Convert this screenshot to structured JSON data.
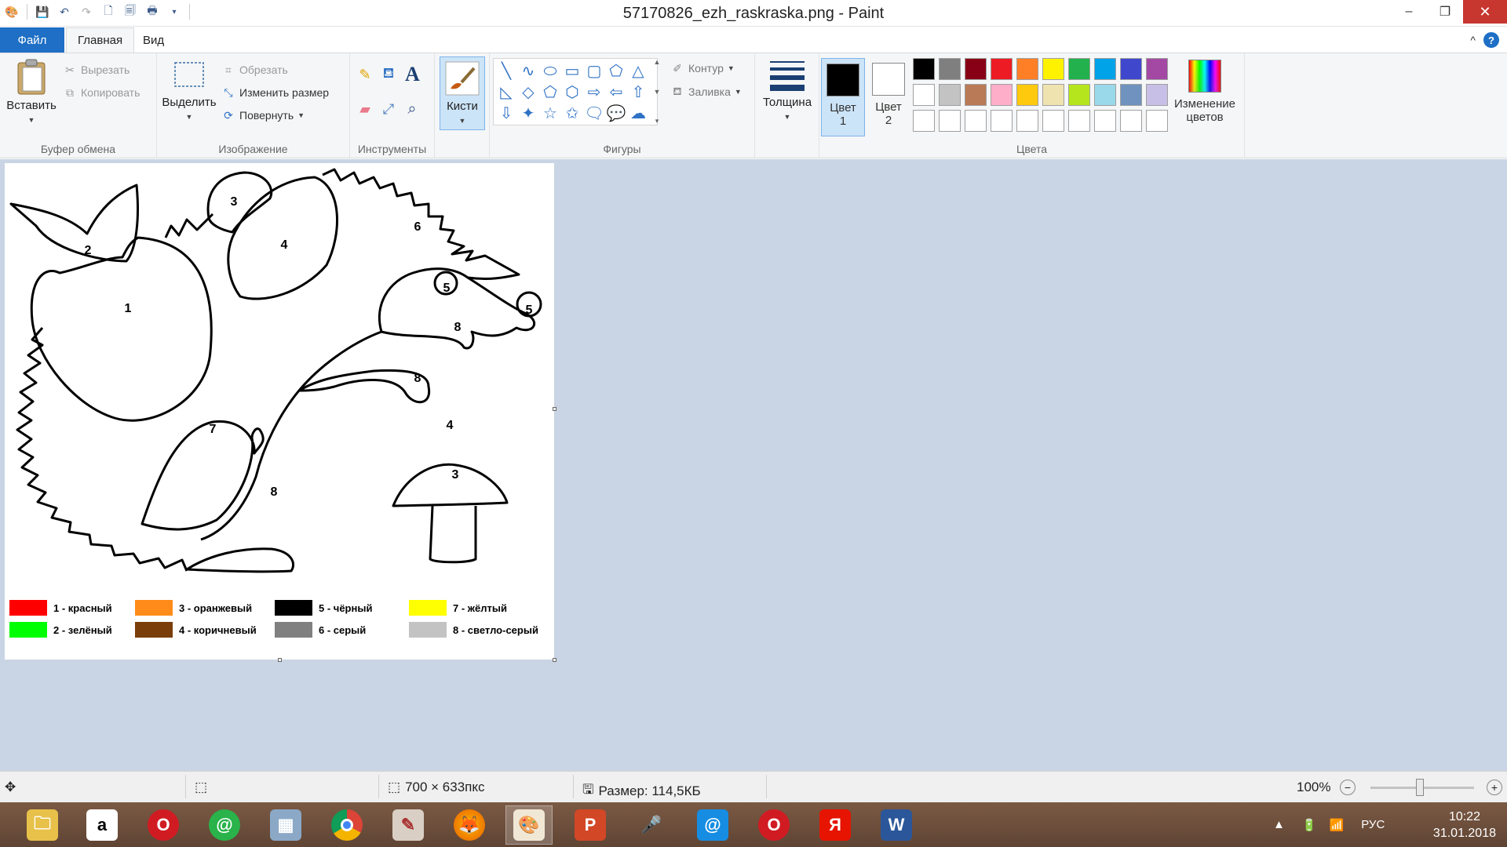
{
  "window": {
    "title": "57170826_ezh_raskraska.png - Paint",
    "minimize": "–",
    "maximize": "❐",
    "close": "✕"
  },
  "tabs": {
    "file": "Файл",
    "home": "Главная",
    "view": "Вид",
    "collapse": "^",
    "help": "?"
  },
  "clipboard": {
    "paste": "Вставить",
    "cut": "Вырезать",
    "copy": "Копировать",
    "label": "Буфер обмена"
  },
  "image": {
    "select": "Выделить",
    "crop": "Обрезать",
    "resize": "Изменить размер",
    "rotate": "Повернуть",
    "label": "Изображение"
  },
  "tools": {
    "label": "Инструменты",
    "text_tool": "A"
  },
  "brushes": {
    "label": "Кисти"
  },
  "shapes": {
    "outline": "Контур",
    "fill": "Заливка",
    "label": "Фигуры",
    "glyphs": [
      "╲",
      "∿",
      "⬭",
      "▭",
      "▢",
      "⬠",
      "△",
      "◺",
      "◇",
      "⬠",
      "⬡",
      "⇨",
      "⇦",
      "⇧",
      "⇩",
      "✦",
      "☆",
      "✩",
      "🗨",
      "💬",
      "☁"
    ]
  },
  "thickness": {
    "label": "Толщина"
  },
  "colors": {
    "color1_label": "Цвет",
    "color1_num": "1",
    "color1_value": "#000000",
    "color2_label": "Цвет",
    "color2_num": "2",
    "color2_value": "#ffffff",
    "edit_line1": "Изменение",
    "edit_line2": "цветов",
    "label": "Цвета",
    "palette": [
      "#000000",
      "#7f7f7f",
      "#880015",
      "#ed1c24",
      "#ff7f27",
      "#fff200",
      "#22b14c",
      "#00a2e8",
      "#3f48cc",
      "#a349a4",
      "#ffffff",
      "#c3c3c3",
      "#b97a57",
      "#ffaec9",
      "#ffc90e",
      "#efe4b0",
      "#b5e61d",
      "#99d9ea",
      "#7092be",
      "#c8bfe7",
      "#ffffff",
      "#ffffff",
      "#ffffff",
      "#ffffff",
      "#ffffff",
      "#ffffff",
      "#ffffff",
      "#ffffff",
      "#ffffff",
      "#ffffff"
    ]
  },
  "picture": {
    "numbers": [
      "2",
      "3",
      "4",
      "6",
      "1",
      "5",
      "5",
      "8",
      "8",
      "4",
      "7",
      "3",
      "8"
    ],
    "legend": [
      {
        "color": "#ff0000",
        "text": "1 - красный"
      },
      {
        "color": "#ff8c1a",
        "text": "3 - оранжевый"
      },
      {
        "color": "#000000",
        "text": "5 - чёрный"
      },
      {
        "color": "#ffff00",
        "text": "7 - жёлтый"
      },
      {
        "color": "#00ff00",
        "text": "2 - зелёный"
      },
      {
        "color": "#7a3e0a",
        "text": "4 - коричневый"
      },
      {
        "color": "#808080",
        "text": "6 - серый"
      },
      {
        "color": "#c3c3c3",
        "text": "8 - светло-серый"
      }
    ]
  },
  "status": {
    "dimensions": "700 × 633пкс",
    "size": "Размер: 114,5КБ",
    "zoom": "100%",
    "zoom_out": "−",
    "zoom_in": "+"
  },
  "taskbar": {
    "lang": "РУС",
    "time": "10:22",
    "date": "31.01.2018"
  }
}
